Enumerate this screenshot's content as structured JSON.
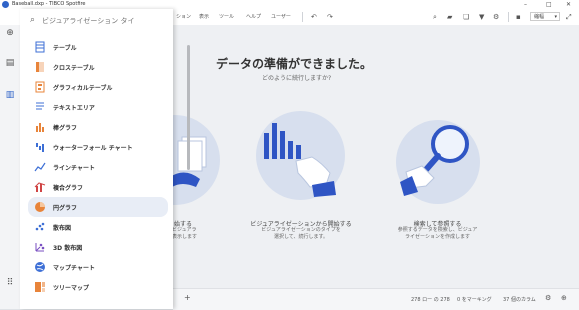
{
  "window": {
    "title": "Baseball.dxp - TIBCO Spotfire",
    "controls": [
      "–",
      "□",
      "✕"
    ]
  },
  "menu": {
    "items": [
      "ション",
      "表示",
      "ツール",
      "ヘルプ",
      "ユーザー"
    ],
    "zoom": "縮幅"
  },
  "search": {
    "placeholder": "ビジュアライゼーション タイ"
  },
  "viz_items": [
    {
      "label": "テーブル",
      "icon": "table-icon",
      "color": "#3d6fd6"
    },
    {
      "label": "クロステーブル",
      "icon": "cross-table-icon",
      "color": "#e8843a"
    },
    {
      "label": "グラフィカルテーブル",
      "icon": "graphical-table-icon",
      "color": "#e8843a"
    },
    {
      "label": "テキストエリア",
      "icon": "text-area-icon",
      "color": "#3d6fd6"
    },
    {
      "label": "棒グラフ",
      "icon": "bar-chart-icon",
      "color": "#e8843a"
    },
    {
      "label": "ウォーターフォール チャート",
      "icon": "waterfall-chart-icon",
      "color": "#3d6fd6"
    },
    {
      "label": "ラインチャート",
      "icon": "line-chart-icon",
      "color": "#3d6fd6"
    },
    {
      "label": "複合グラフ",
      "icon": "combination-chart-icon",
      "color": "#d04545"
    },
    {
      "label": "円グラフ",
      "icon": "pie-chart-icon",
      "color": "#e8843a"
    },
    {
      "label": "散布図",
      "icon": "scatter-plot-icon",
      "color": "#3d6fd6"
    },
    {
      "label": "3D 散布図",
      "icon": "3d-scatter-plot-icon",
      "color": "#7a4fc2"
    },
    {
      "label": "マップチャート",
      "icon": "map-chart-icon",
      "color": "#3d6fd6"
    },
    {
      "label": "ツリーマップ",
      "icon": "treemap-icon",
      "color": "#e8843a"
    }
  ],
  "selected_index": 8,
  "main": {
    "heading": "データの準備ができました。",
    "subheading": "どのように続行しますか?",
    "cards": [
      {
        "title": "始する",
        "desc": [
          "ビジュアラ",
          "表示します"
        ]
      },
      {
        "title": "ビジュアライゼーションから開始する",
        "desc": [
          "ビジュアライゼーションのタイプを",
          "選択して、続行します。"
        ]
      },
      {
        "title": "検索して参照する",
        "desc": [
          "参照するデータを検索し、ビジュア",
          "ライゼーションを作成します"
        ]
      }
    ]
  },
  "status": {
    "add": "+",
    "rows": "278 ロー の 278",
    "marking": "0 をマーキング",
    "columns": "37 個のカラム"
  },
  "colors": {
    "accent": "#2f63c8",
    "selected_bg": "#e8edf6",
    "circle": "#d7dfee"
  }
}
